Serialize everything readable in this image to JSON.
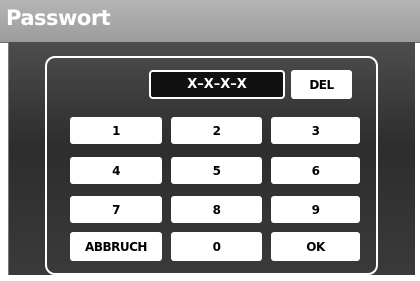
{
  "window": {
    "title": "Passwort"
  },
  "password": {
    "display": "X–X–X–X"
  },
  "buttons": {
    "del": "DEL",
    "k1": "1",
    "k2": "2",
    "k3": "3",
    "k4": "4",
    "k5": "5",
    "k6": "6",
    "k7": "7",
    "k8": "8",
    "k9": "9",
    "cancel": "ABBRUCH",
    "k0": "0",
    "ok": "OK"
  }
}
